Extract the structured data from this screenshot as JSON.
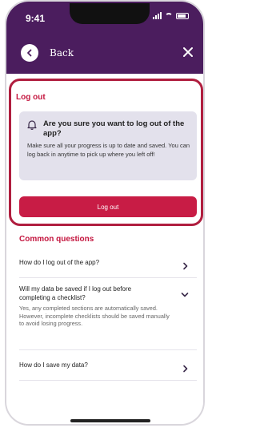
{
  "status_bar": {
    "time": "9:41"
  },
  "nav": {
    "back_label": "Back"
  },
  "logout_section": {
    "title": "Log out",
    "notice_title": "Are you sure you want to log out of the app?",
    "notice_body": "Make sure all your progress is up to date and saved. You can log back in anytime to pick up where you left off!",
    "button_label": "Log out"
  },
  "faq": {
    "title": "Common questions",
    "items": [
      {
        "question": "How do I log out of the app?",
        "answer": "",
        "expanded": false
      },
      {
        "question": "Will my data be saved if I log out before completing a checklist?",
        "answer": "Yes, any completed sections are automatically saved. However, incomplete checklists should be saved manually to avoid losing progress.",
        "expanded": true
      },
      {
        "question": "How do I save my data?",
        "answer": "",
        "expanded": false
      }
    ]
  },
  "colors": {
    "header_bg": "#4b1d5e",
    "accent": "#c81c45",
    "highlight_border": "#b01e3f",
    "notice_bg": "#e3e1ec"
  },
  "icons": [
    "back-arrow-icon",
    "close-icon",
    "bell-icon",
    "chevron-right-icon",
    "chevron-down-icon"
  ]
}
